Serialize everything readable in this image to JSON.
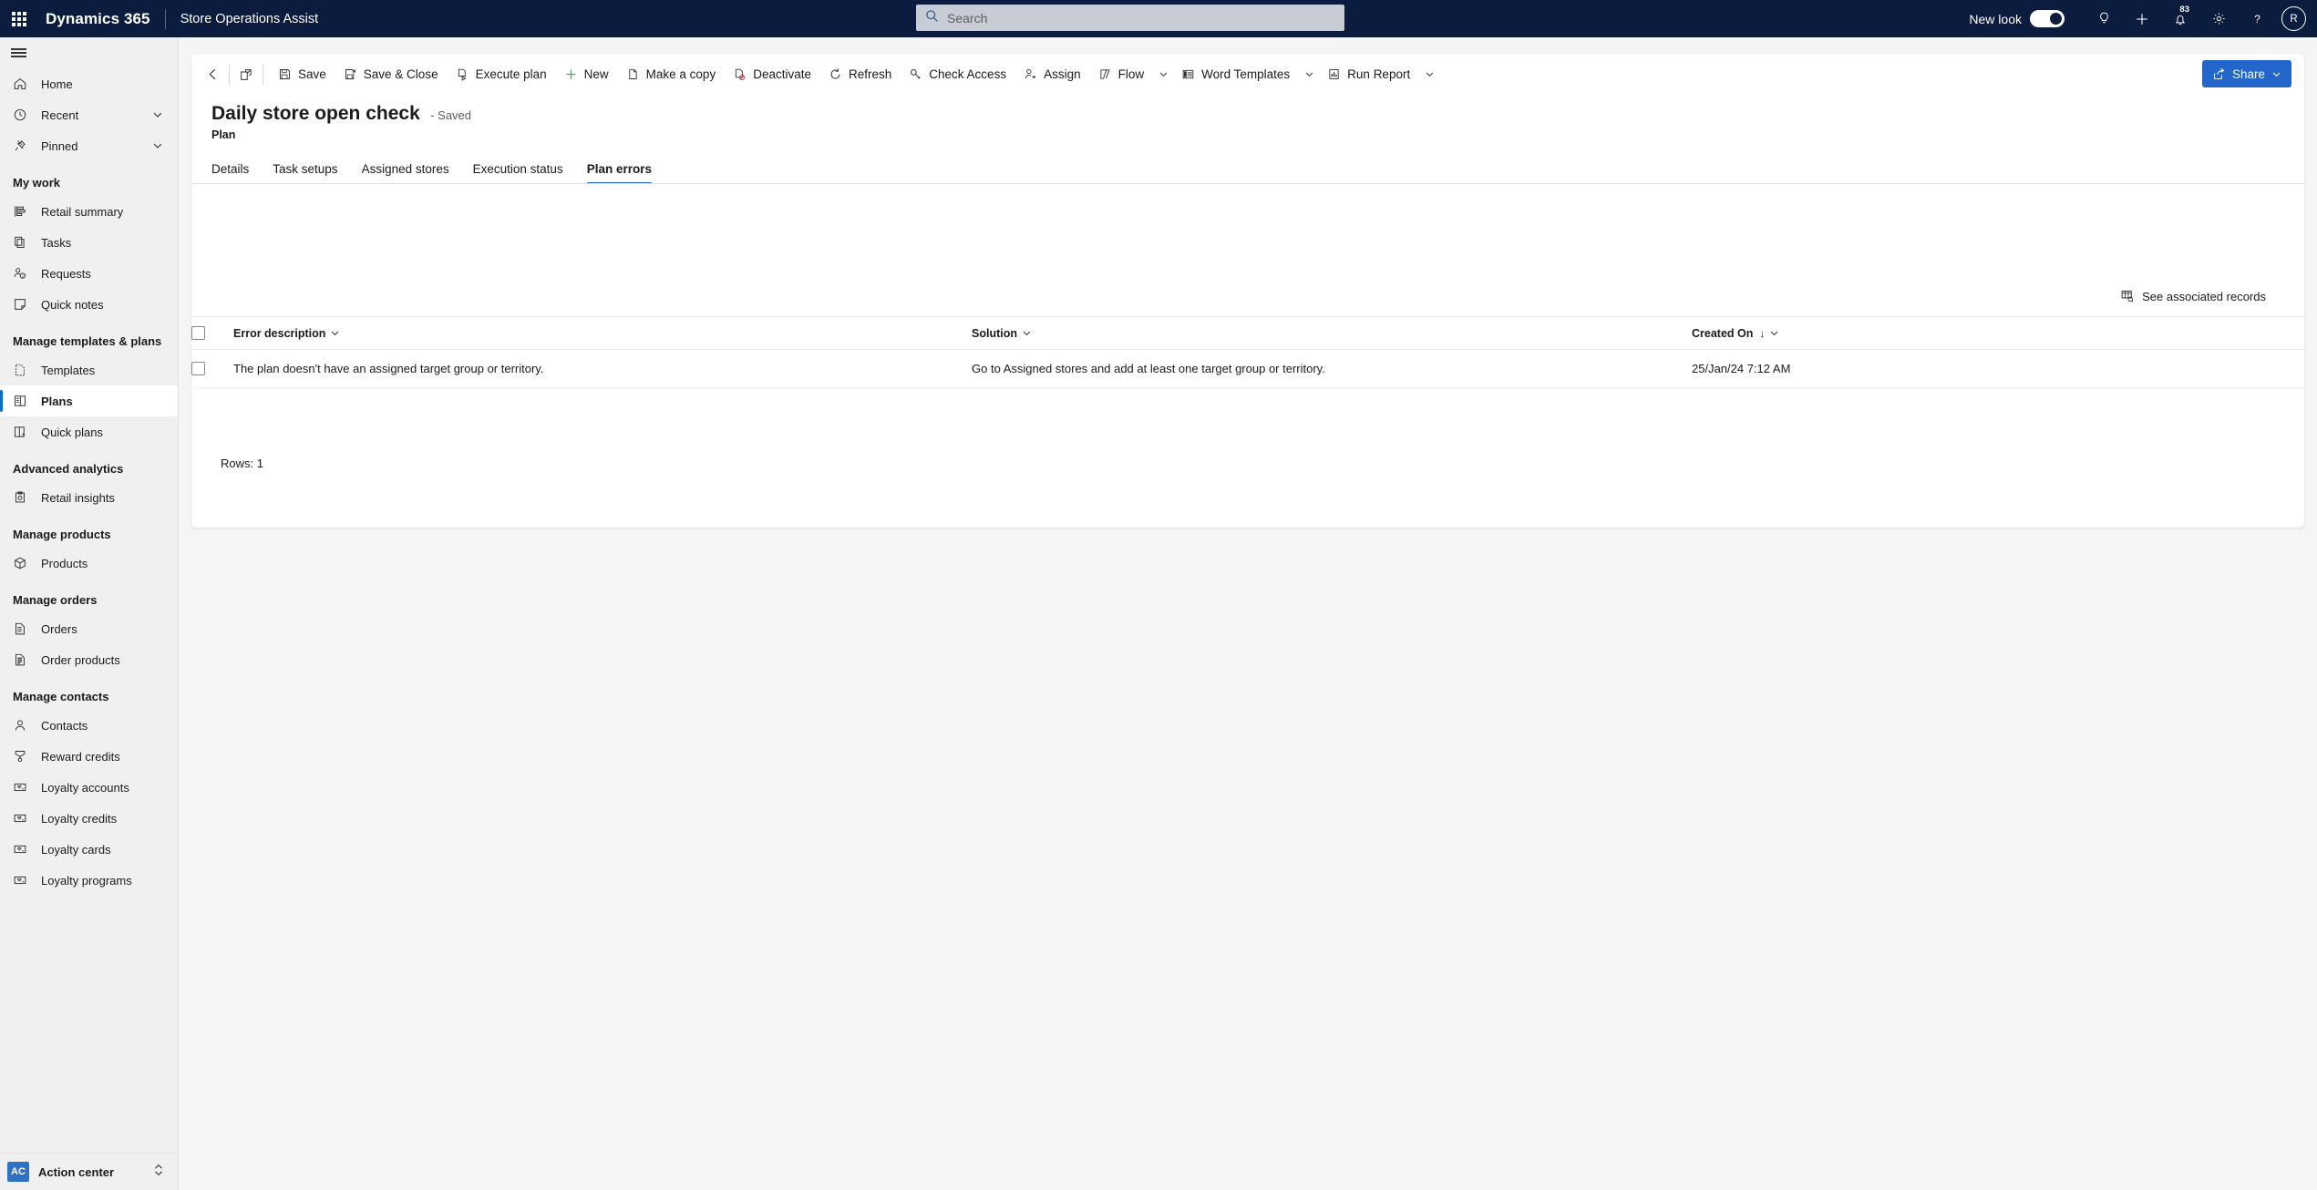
{
  "header": {
    "waffle_icon": "app-launcher-icon",
    "brand": "Dynamics 365",
    "app_name": "Store Operations Assist",
    "search": {
      "placeholder": "Search",
      "value": "",
      "icon": "search-icon"
    },
    "new_look_label": "New look",
    "new_look_state": "on",
    "icons": [
      {
        "name": "lightbulb-icon",
        "label": ""
      },
      {
        "name": "plus-icon",
        "label": ""
      },
      {
        "name": "bell-icon",
        "label": "",
        "badge": "83"
      },
      {
        "name": "gear-icon",
        "label": ""
      },
      {
        "name": "question-icon",
        "label": ""
      }
    ],
    "avatar_initials": "R",
    "bar_color": "#0b1c3f"
  },
  "sidebar": {
    "hamburger_icon": "hamburger-icon",
    "top_items": [
      {
        "label": "Home",
        "icon": "home-icon",
        "chevron": false
      },
      {
        "label": "Recent",
        "icon": "clock-icon",
        "chevron": true
      },
      {
        "label": "Pinned",
        "icon": "pin-icon",
        "chevron": true
      }
    ],
    "groups": [
      {
        "title": "My work",
        "items": [
          {
            "label": "Retail summary",
            "icon": "retail-summary-icon"
          },
          {
            "label": "Tasks",
            "icon": "tasks-icon"
          },
          {
            "label": "Requests",
            "icon": "requests-icon"
          },
          {
            "label": "Quick notes",
            "icon": "quick-notes-icon"
          }
        ]
      },
      {
        "title": "Manage templates & plans",
        "items": [
          {
            "label": "Templates",
            "icon": "templates-icon"
          },
          {
            "label": "Plans",
            "icon": "plans-icon",
            "active": true
          },
          {
            "label": "Quick plans",
            "icon": "quick-plans-icon"
          }
        ]
      },
      {
        "title": "Advanced analytics",
        "items": [
          {
            "label": "Retail insights",
            "icon": "retail-insights-icon"
          }
        ]
      },
      {
        "title": "Manage products",
        "items": [
          {
            "label": "Products",
            "icon": "product-box-icon"
          }
        ]
      },
      {
        "title": "Manage orders",
        "items": [
          {
            "label": "Orders",
            "icon": "orders-icon"
          },
          {
            "label": "Order products",
            "icon": "order-products-icon"
          }
        ]
      },
      {
        "title": "Manage contacts",
        "items": [
          {
            "label": "Contacts",
            "icon": "contact-icon"
          },
          {
            "label": "Reward credits",
            "icon": "reward-icon"
          },
          {
            "label": "Loyalty accounts",
            "icon": "loyalty-card-icon"
          },
          {
            "label": "Loyalty credits",
            "icon": "loyalty-card-icon"
          },
          {
            "label": "Loyalty cards",
            "icon": "loyalty-card-icon"
          },
          {
            "label": "Loyalty programs",
            "icon": "loyalty-card-icon"
          }
        ]
      }
    ],
    "action_center": {
      "badge": "AC",
      "label": "Action center",
      "icon": "expand-collapse-icon"
    }
  },
  "command_bar": {
    "back_icon": "back-arrow-icon",
    "popout_icon": "open-in-new-window-icon",
    "buttons": [
      {
        "label": "Save",
        "icon": "save-icon"
      },
      {
        "label": "Save & Close",
        "icon": "save-and-close-icon"
      },
      {
        "label": "Execute plan",
        "icon": "execute-plan-icon"
      },
      {
        "label": "New",
        "icon": "plus-icon"
      },
      {
        "label": "Make a copy",
        "icon": "copy-icon"
      },
      {
        "label": "Deactivate",
        "icon": "deactivate-icon"
      },
      {
        "label": "Refresh",
        "icon": "refresh-icon"
      },
      {
        "label": "Check Access",
        "icon": "key-icon"
      },
      {
        "label": "Assign",
        "icon": "assign-user-icon"
      },
      {
        "label": "Flow",
        "icon": "flow-icon",
        "caret": true
      },
      {
        "label": "Word Templates",
        "icon": "word-templates-icon",
        "caret": true
      },
      {
        "label": "Run Report",
        "icon": "run-report-icon",
        "caret": true
      }
    ],
    "share": {
      "label": "Share",
      "icon": "share-icon",
      "caret": true,
      "color": "#2266cc"
    }
  },
  "record": {
    "title": "Daily store open check",
    "saved_state": "- Saved",
    "entity": "Plan",
    "tabs": [
      {
        "label": "Details",
        "active": false
      },
      {
        "label": "Task setups",
        "active": false
      },
      {
        "label": "Assigned stores",
        "active": false
      },
      {
        "label": "Execution status",
        "active": false
      },
      {
        "label": "Plan errors",
        "active": true
      }
    ]
  },
  "grid": {
    "associated_records_label": "See associated records",
    "associated_records_icon": "associated-records-icon",
    "columns": [
      {
        "label": "Error description",
        "sort": "",
        "chevron": true
      },
      {
        "label": "Solution",
        "sort": "",
        "chevron": true
      },
      {
        "label": "Created On",
        "sort": "↓",
        "chevron": true
      }
    ],
    "rows": [
      {
        "error_description": "The plan doesn't have an assigned target group or territory.",
        "solution": "Go to Assigned stores and add at least one target group or territory.",
        "created_on": "25/Jan/24 7:12 AM"
      }
    ],
    "rows_count_label": "Rows: 1"
  }
}
